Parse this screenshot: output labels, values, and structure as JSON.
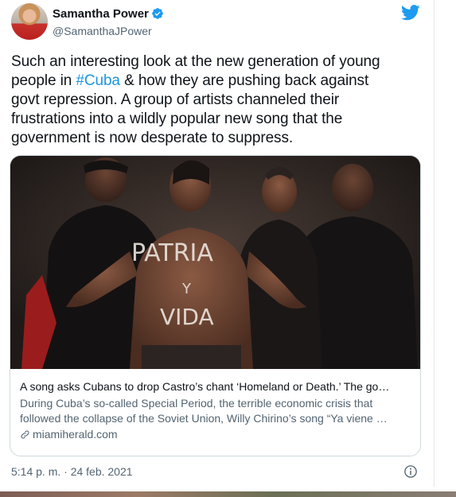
{
  "author": {
    "name": "Samantha Power",
    "handle": "@SamanthaJPower",
    "avatar_icon": "profile-photo",
    "verified_icon": "verified-badge-icon"
  },
  "brand_icon": "twitter-bird-icon",
  "colors": {
    "twitter_blue": "#1d9bf0",
    "hashtag": "#1b95e0",
    "text_primary": "#0f1419",
    "text_secondary": "#536471",
    "border": "#cfd9de"
  },
  "tweet": {
    "line1": "Such an interesting look at the new generation of young",
    "line2_prefix": "people in ",
    "line2_hashtag": "#Cuba",
    "line2_suffix": " & how they are pushing back against",
    "line3": "govt repression. A group of artists channeled their",
    "line4": "frustrations into a wildly popular new song that the",
    "line5": "government is now desperate to suppress."
  },
  "card": {
    "image_text": {
      "line1": "PATRIA",
      "line2": "Y",
      "line3": "VIDA"
    },
    "title": "A song asks Cubans to drop Castro’s chant ‘Homeland or Death.’ The go…",
    "description_line1": "During Cuba’s so-called Special Period, the terrible economic crisis that",
    "description_line2": "followed the collapse of the Soviet Union, Willy Chirino’s song “Ya viene …",
    "domain": "miamiherald.com",
    "link_icon": "link-icon"
  },
  "footer": {
    "timestamp": "5:14 p. m. · 24 feb. 2021",
    "info_icon": "info-icon"
  }
}
